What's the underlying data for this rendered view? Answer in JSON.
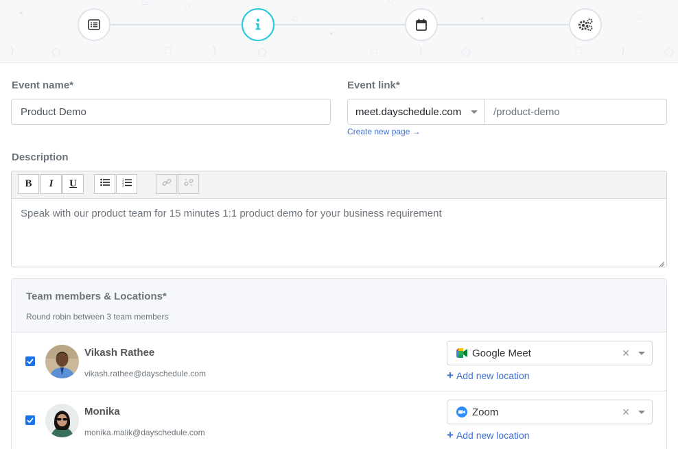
{
  "stepper": {
    "steps": [
      {
        "icon": "list-icon",
        "state": "done"
      },
      {
        "icon": "info-icon",
        "state": "active"
      },
      {
        "icon": "calendar-icon",
        "state": "pending"
      },
      {
        "icon": "settings-icon",
        "state": "pending"
      }
    ],
    "accent": "#26c6da"
  },
  "event_name": {
    "label": "Event name*",
    "value": "Product Demo"
  },
  "event_link": {
    "label": "Event link*",
    "domain": "meet.dayschedule.com",
    "slug": "/product-demo",
    "create_page": "Create new page →"
  },
  "description": {
    "label": "Description",
    "toolbar": {
      "bold": "B",
      "italic": "I",
      "underline": "U"
    },
    "text": "Speak with our product team for 15 minutes 1:1 product demo for your business requirement"
  },
  "team": {
    "title": "Team members & Locations*",
    "subtitle": "Round robin between 3 team members",
    "add_location": "Add new location",
    "members": [
      {
        "name": "Vikash Rathee",
        "email": "vikash.rathee@dayschedule.com",
        "checked": true,
        "location": "Google Meet",
        "location_icon": "google-meet-icon"
      },
      {
        "name": "Monika",
        "email": "monika.malik@dayschedule.com",
        "checked": true,
        "location": "Zoom",
        "location_icon": "zoom-icon"
      }
    ]
  },
  "colors": {
    "link": "#3f6fd1",
    "checkbox": "#1a73e8"
  }
}
